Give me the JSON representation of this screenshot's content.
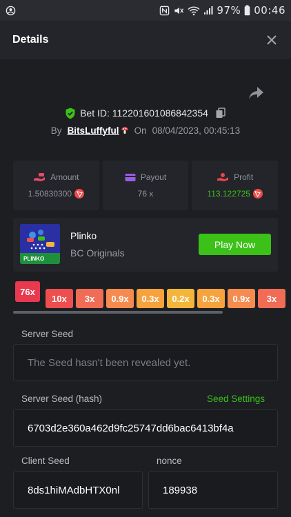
{
  "status_bar": {
    "battery": "97%",
    "time": "00:46"
  },
  "header": {
    "title": "Details"
  },
  "bet": {
    "id_label": "Bet ID: 112201601086842354",
    "by_label": "By",
    "user": "BitsLuffyful",
    "on_label": "On",
    "date": "08/04/2023, 00:45:13"
  },
  "stats": {
    "amount_label": "Amount",
    "amount_value": "1.50830300",
    "payout_label": "Payout",
    "payout_value": "76 x",
    "profit_label": "Profit",
    "profit_value": "113.122725"
  },
  "game": {
    "name": "Plinko",
    "provider": "BC Originals",
    "play_label": "Play Now",
    "thumb_text": "PLINKO"
  },
  "multipliers": [
    "76x",
    "10x",
    "3x",
    "0.9x",
    "0.3x",
    "0.2x",
    "0.3x",
    "0.9x",
    "3x"
  ],
  "fields": {
    "server_seed_label": "Server Seed",
    "server_seed_value": "The Seed hasn't been revealed yet.",
    "server_hash_label": "Server Seed (hash)",
    "seed_settings_label": "Seed Settings",
    "server_hash_value": "6703d2e360a462d9fc25747dd6bac6413bf4a",
    "client_seed_label": "Client Seed",
    "client_seed_value": "8ds1hiMAdbHTX0nl",
    "nonce_label": "nonce",
    "nonce_value": "189938"
  },
  "colors": {
    "accent_green": "#3bc117",
    "bg": "#1c1e22",
    "card": "#23252a",
    "mult_76x": "#e8394f",
    "mult_10x": "#ee4e4e",
    "mult_3x": "#f06c55",
    "mult_09x": "#f58b4e",
    "mult_03x": "#f6a33e",
    "mult_02x": "#f4b63a"
  }
}
